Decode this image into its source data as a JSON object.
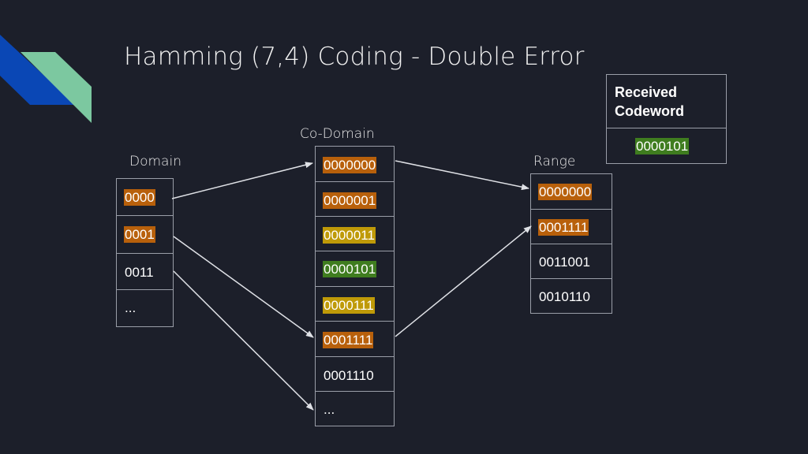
{
  "title": "Hamming (7,4) Coding - Double Error",
  "colors": {
    "background": "#1c1f2a",
    "logo_blue": "#0a47b5",
    "logo_green": "#7cc8a0",
    "highlight_orange": "#b8600b",
    "highlight_yellow": "#bf9a08",
    "highlight_green": "#3f7d1f",
    "border": "#9a9ea8"
  },
  "domain": {
    "label": "Domain",
    "items": [
      {
        "value": "0000",
        "highlight": "orange"
      },
      {
        "value": "0001",
        "highlight": "orange"
      },
      {
        "value": "0011",
        "highlight": "none"
      },
      {
        "value": "...",
        "highlight": "none"
      }
    ]
  },
  "codomain": {
    "label": "Co-Domain",
    "items": [
      {
        "value": "0000000",
        "highlight": "orange"
      },
      {
        "value": "0000001",
        "highlight": "orange"
      },
      {
        "value": "0000011",
        "highlight": "yellow"
      },
      {
        "value": "0000101",
        "highlight": "green"
      },
      {
        "value": "0000111",
        "highlight": "yellow"
      },
      {
        "value": "0001111",
        "highlight": "orange"
      },
      {
        "value": "0001110",
        "highlight": "none"
      },
      {
        "value": "...",
        "highlight": "none"
      }
    ]
  },
  "range": {
    "label": "Range",
    "items": [
      {
        "value": "0000000",
        "highlight": "orange"
      },
      {
        "value": "0001111",
        "highlight": "orange"
      },
      {
        "value": "0011001",
        "highlight": "none"
      },
      {
        "value": "0010110",
        "highlight": "none"
      }
    ]
  },
  "received": {
    "header_line1": "Received",
    "header_line2": "Codeword",
    "value": "0000101",
    "highlight": "green"
  },
  "mappings": [
    {
      "from": "domain.0",
      "to": "codomain.0"
    },
    {
      "from": "domain.1",
      "to": "codomain.5"
    },
    {
      "from": "domain.2",
      "to": "codomain.7"
    },
    {
      "from": "codomain.0",
      "to": "range.0"
    },
    {
      "from": "codomain.5",
      "to": "range.1"
    }
  ]
}
